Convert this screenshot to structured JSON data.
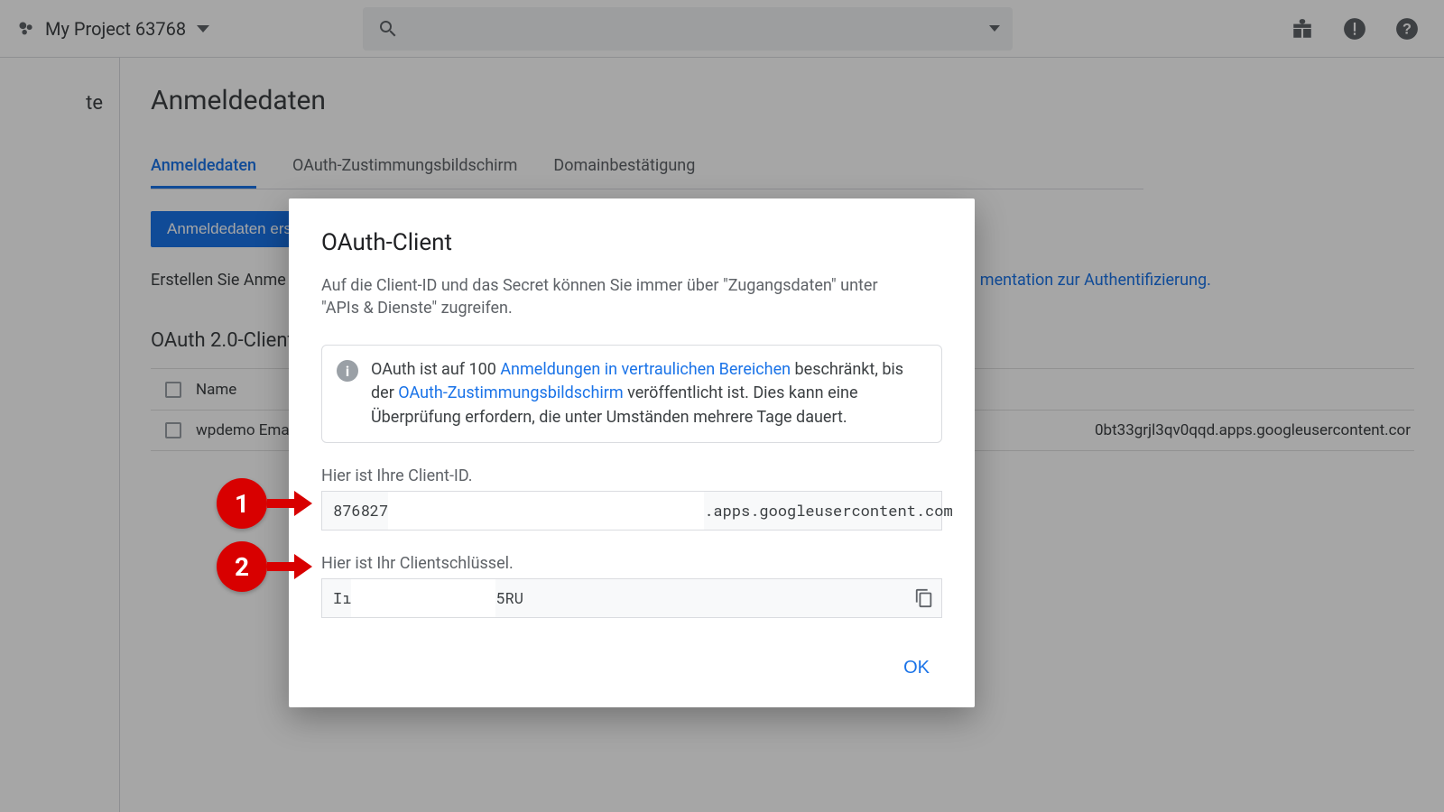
{
  "topbar": {
    "project_name": "My Project 63768",
    "search_placeholder": ""
  },
  "sidenav": {
    "item0": "te"
  },
  "page": {
    "title": "Anmeldedaten",
    "tabs": [
      "Anmeldedaten",
      "OAuth-Zustimmungsbildschirm",
      "Domainbestätigung"
    ],
    "create_button": "Anmeldedaten ers",
    "hint_prefix": "Erstellen Sie Anme",
    "auth_doc_link": "mentation zur Authentifizierung.",
    "section_heading": "OAuth 2.0-Client-",
    "table": {
      "header_name": "Name",
      "rows": [
        {
          "name": "wpdemo Ema",
          "client_id_suffix": "0bt33grjl3qv0qqd.apps.googleusercontent.cor"
        }
      ]
    }
  },
  "modal": {
    "title": "OAuth-Client",
    "subtitle": "Auf die Client-ID und das Secret können Sie immer über \"Zugangsdaten\" unter \"APIs & Dienste\" zugreifen.",
    "info_pre": "OAuth ist auf 100 ",
    "info_link1": "Anmeldungen in vertraulichen Bereichen",
    "info_mid1": " beschränkt, bis der ",
    "info_link2": "OAuth-Zustimmungsbildschirm",
    "info_post": " veröffentlicht ist. Dies kann eine Überprüfung erfordern, die unter Umständen mehrere Tage dauert.",
    "client_id_label": "Hier ist Ihre Client-ID.",
    "client_id_left": "876827",
    "client_id_right": ".apps.googleusercontent.com",
    "secret_label": "Hier ist Ihr Clientschlüssel.",
    "secret_left": "Iı",
    "secret_right": "5RU",
    "ok": "OK"
  },
  "callouts": {
    "n1": "1",
    "n2": "2"
  }
}
